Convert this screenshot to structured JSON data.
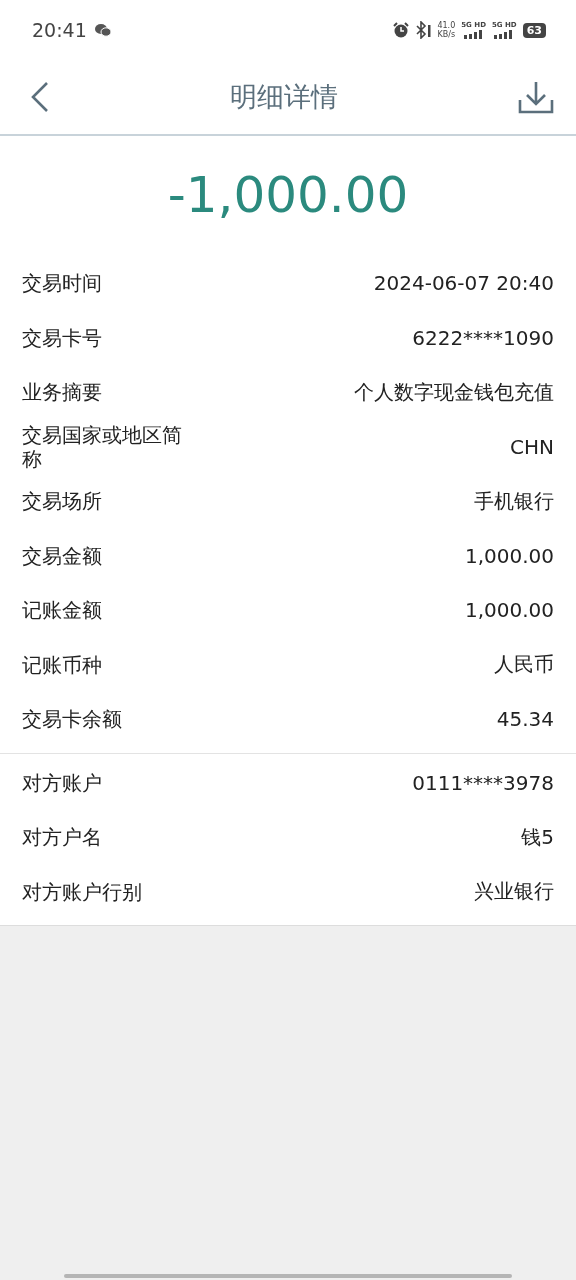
{
  "status_bar": {
    "time": "20:41",
    "speed": "41.0",
    "speed_unit": "KB/s",
    "networks": [
      "5G HD",
      "5G HD"
    ],
    "battery": "63"
  },
  "header": {
    "title": "明细详情"
  },
  "amount": "-1,000.00",
  "sections": [
    {
      "rows": [
        {
          "label": "交易时间",
          "value": "2024-06-07 20:40"
        },
        {
          "label": "交易卡号",
          "value": "6222****1090"
        },
        {
          "label": "业务摘要",
          "value": "个人数字现金钱包充值"
        },
        {
          "label": "交易国家或地区简称",
          "value": "CHN"
        },
        {
          "label": "交易场所",
          "value": "手机银行"
        },
        {
          "label": "交易金额",
          "value": "1,000.00"
        },
        {
          "label": "记账金额",
          "value": "1,000.00"
        },
        {
          "label": "记账币种",
          "value": "人民币"
        },
        {
          "label": "交易卡余额",
          "value": "45.34"
        }
      ]
    },
    {
      "rows": [
        {
          "label": "对方账户",
          "value": "0111****3978"
        },
        {
          "label": "对方户名",
          "value": "钱5"
        },
        {
          "label": "对方账户行别",
          "value": "兴业银行"
        }
      ]
    }
  ]
}
